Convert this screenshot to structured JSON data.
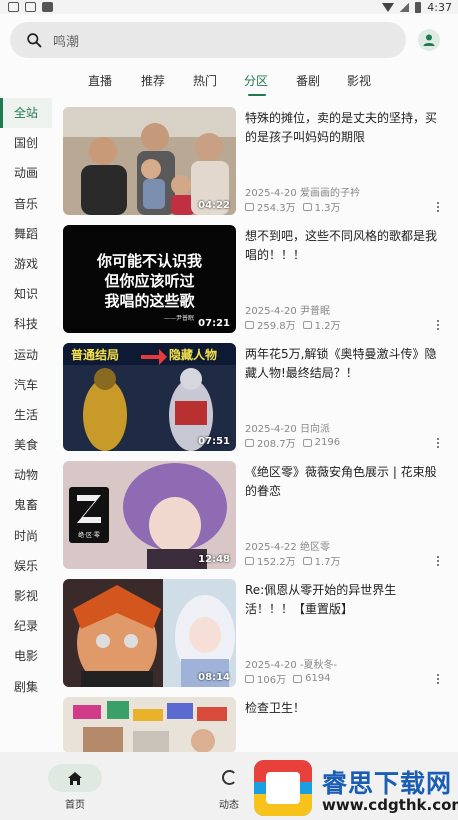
{
  "status_bar": {
    "time": "4:37"
  },
  "search": {
    "placeholder": "鸣潮"
  },
  "tabs": [
    {
      "label": "直播"
    },
    {
      "label": "推荐"
    },
    {
      "label": "热门"
    },
    {
      "label": "分区",
      "active": true
    },
    {
      "label": "番剧"
    },
    {
      "label": "影视"
    }
  ],
  "sidebar": {
    "items": [
      "全站",
      "国创",
      "动画",
      "音乐",
      "舞蹈",
      "游戏",
      "知识",
      "科技",
      "运动",
      "汽车",
      "生活",
      "美食",
      "动物",
      "鬼畜",
      "时尚",
      "娱乐",
      "影视",
      "纪录",
      "电影",
      "剧集"
    ],
    "active": "全站"
  },
  "videos": [
    {
      "title": "特殊的摊位，卖的是丈夫的坚持，买的是孩子叫妈妈的期限",
      "date": "2025-4-20",
      "author": "爱画画的子衿",
      "views": "254.3万",
      "comments": "1.3万",
      "duration": "04:22"
    },
    {
      "title": "想不到吧，这些不同风格的歌都是我唱的！！！",
      "date": "2025-4-20",
      "author": "尹普眠",
      "views": "259.8万",
      "comments": "1.2万",
      "duration": "07:21",
      "thumb_text": [
        "你可能不认识我",
        "但你应该听过",
        "我唱的这些歌",
        "——尹普眠"
      ]
    },
    {
      "title": "两年花5万,解锁《奥特曼激斗传》隐藏人物!最终结局？！",
      "date": "2025-4-20",
      "author": "日向派",
      "views": "208.7万",
      "comments": "2196",
      "duration": "07:51",
      "thumb_text": [
        "普通结局",
        "隐藏人物"
      ]
    },
    {
      "title": "《绝区零》薇薇安角色展示 | 花束般的眷恋",
      "date": "2025-4-22",
      "author": "绝区零",
      "views": "152.2万",
      "comments": "1.7万",
      "duration": "12:48",
      "thumb_text": [
        "绝·区·零"
      ]
    },
    {
      "title": "Re:佩恩从零开始的异世界生活！！！【重置版】",
      "date": "2025-4-20",
      "author": "-夏秋冬-",
      "views": "106万",
      "comments": "6194",
      "duration": "08:14"
    },
    {
      "title": "检查卫生！",
      "date": "",
      "author": "",
      "views": "",
      "comments": "",
      "duration": ""
    }
  ],
  "bottom_nav": [
    {
      "label": "首页",
      "active": true
    },
    {
      "label": "动态"
    }
  ],
  "watermark": {
    "title": "睿思下载网",
    "url": "www.cdgthk.com"
  },
  "colors": {
    "accent": "#1f7a4f",
    "background": "#fbfbfb"
  }
}
